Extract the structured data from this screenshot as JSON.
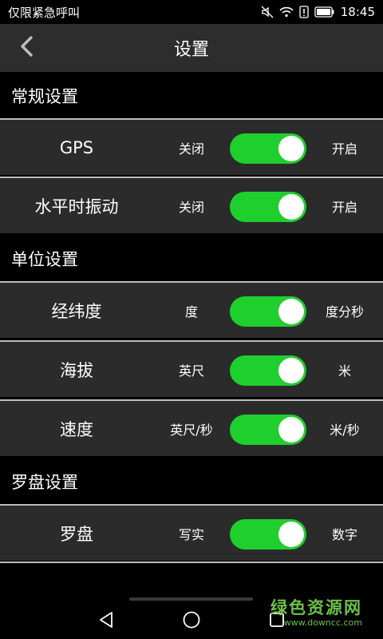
{
  "status": {
    "left_text": "仅限紧急呼叫",
    "time": "18:45"
  },
  "header": {
    "title": "设置",
    "back_icon": "chevron-left-icon"
  },
  "sections": [
    {
      "title": "常规设置",
      "rows": [
        {
          "label": "GPS",
          "left": "关闭",
          "right": "开启",
          "on": true
        },
        {
          "label": "水平时振动",
          "left": "关闭",
          "right": "开启",
          "on": true
        }
      ]
    },
    {
      "title": "单位设置",
      "rows": [
        {
          "label": "经纬度",
          "left": "度",
          "right": "度分秒",
          "on": true
        },
        {
          "label": "海拔",
          "left": "英尺",
          "right": "米",
          "on": true
        },
        {
          "label": "速度",
          "left": "英尺/秒",
          "right": "米/秒",
          "on": true
        }
      ]
    },
    {
      "title": "罗盘设置",
      "rows": [
        {
          "label": "罗盘",
          "left": "写实",
          "right": "数字",
          "on": true
        }
      ]
    }
  ],
  "colors": {
    "toggle_on": "#1fcf2d",
    "row_bg": "#2b2b2b",
    "header_bg": "#2d2d2d",
    "watermark": "#6cc04a"
  },
  "watermark": {
    "title": "绿色资源网",
    "url": "www.downcc.com"
  }
}
